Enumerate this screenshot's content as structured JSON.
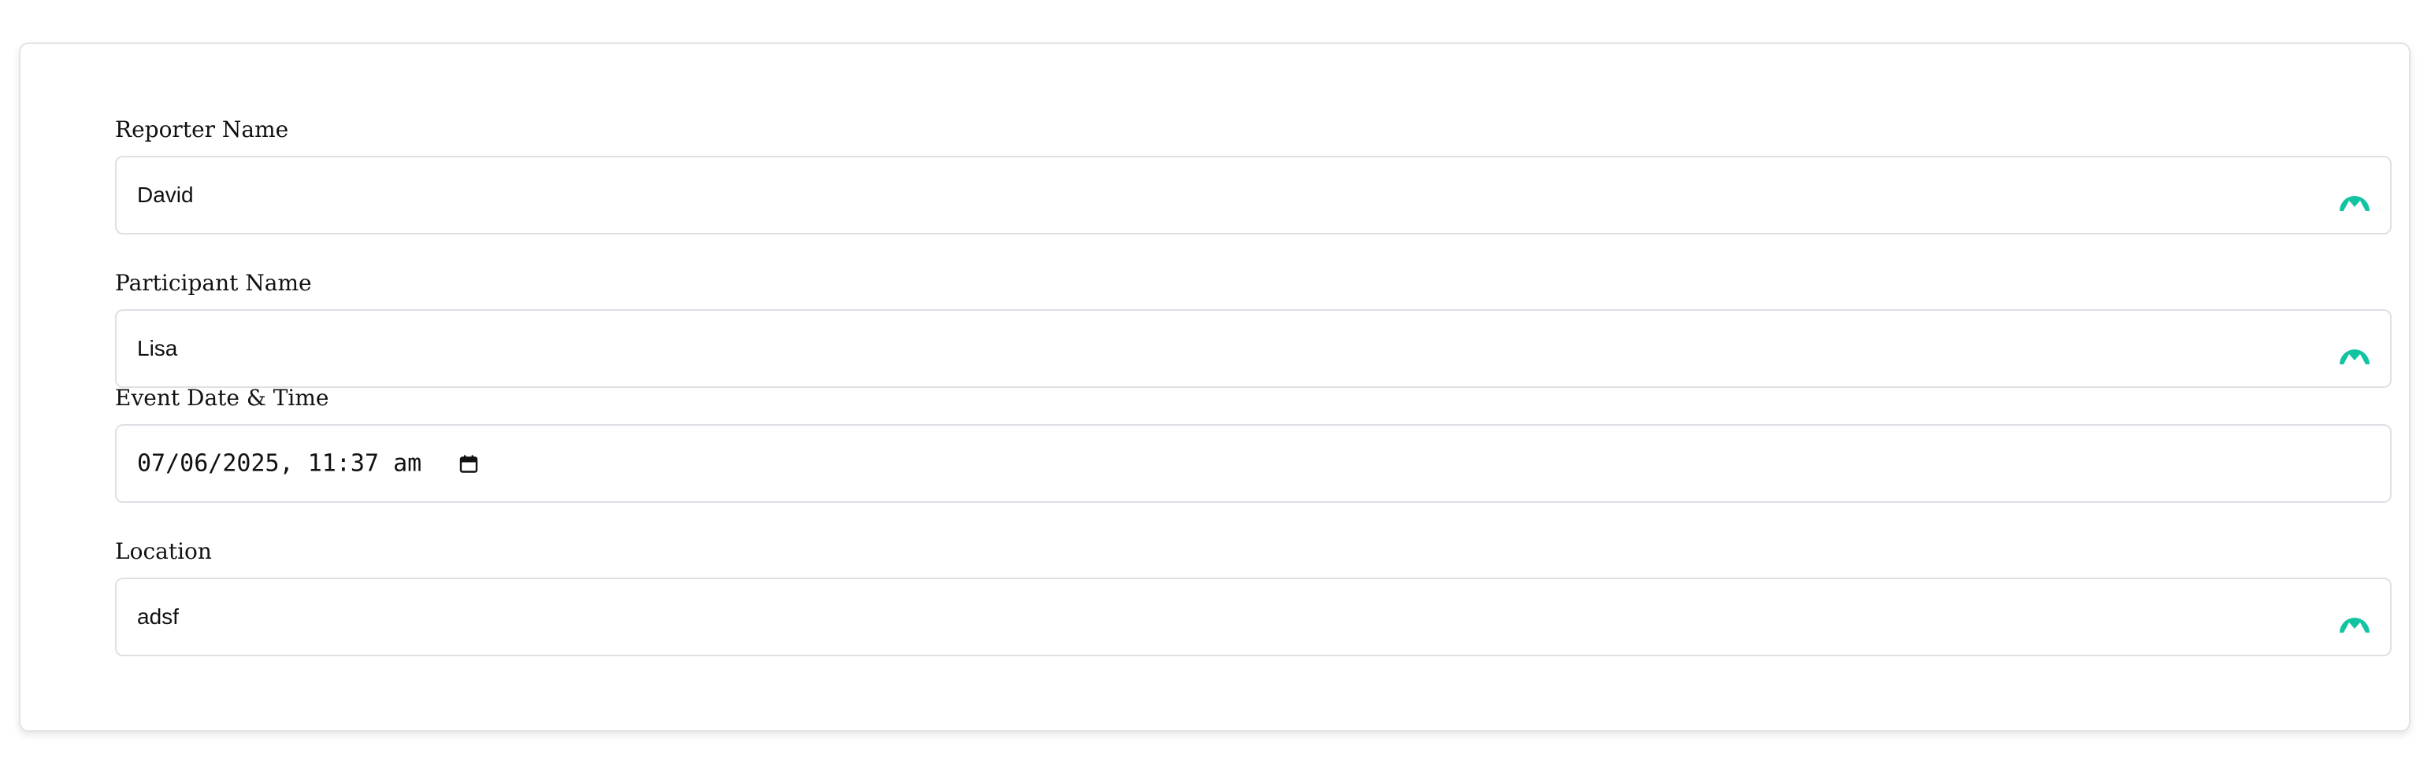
{
  "form": {
    "reporter": {
      "label": "Reporter Name",
      "value": "David"
    },
    "participant": {
      "label": "Participant Name",
      "value": "Lisa"
    },
    "event": {
      "label": "Event Date & Time",
      "value": "07/06/2025, 11:37 am"
    },
    "location": {
      "label": "Location",
      "value": "adsf"
    }
  },
  "icons": {
    "autofill": "autofill-extension-icon",
    "calendar": "calendar-icon"
  },
  "colors": {
    "accent": "#13c4a3",
    "border": "#dde1e6"
  }
}
